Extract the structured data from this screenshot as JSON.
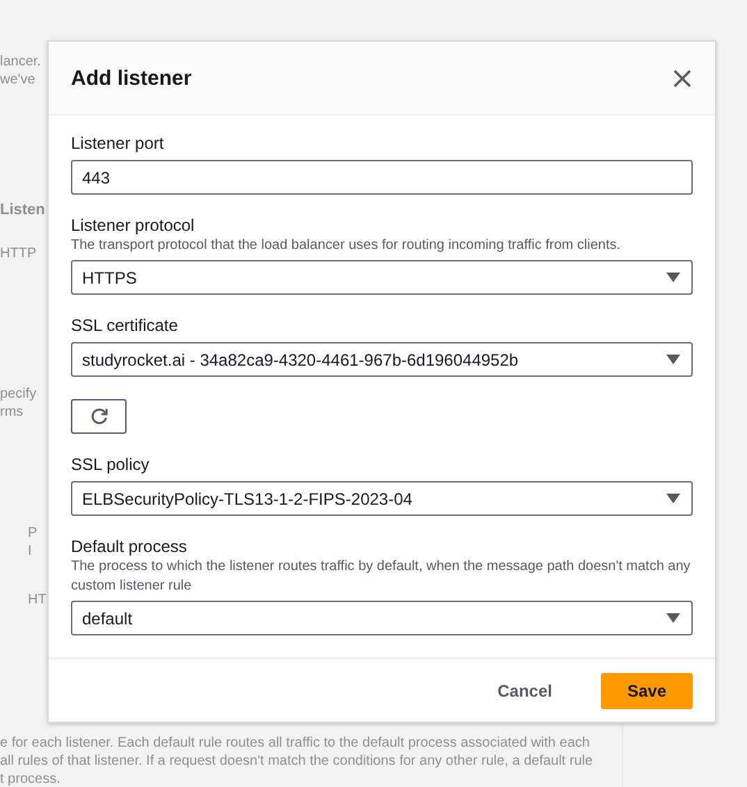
{
  "backdrop": {
    "groups": [
      {
        "kind": "note",
        "lines": [
          "lancer.",
          "we've"
        ]
      },
      {
        "kind": "heading",
        "lines": [
          "Listen"
        ]
      },
      {
        "kind": "cell",
        "lines": [
          "HTTP"
        ]
      },
      {
        "kind": "note",
        "lines": [
          "pecify",
          "rms"
        ]
      },
      {
        "kind": "cell",
        "lines": [
          "P",
          "I"
        ]
      },
      {
        "kind": "cell",
        "lines": [
          "HT"
        ]
      },
      {
        "kind": "paragraph",
        "lines": [
          "e for each listener. Each default rule routes all traffic to the default process associated with each",
          "all rules of that listener. If a request doesn't match the conditions for any other rule, a default rule",
          "t process."
        ]
      }
    ]
  },
  "modal": {
    "title": "Add listener",
    "fields": [
      {
        "kind": "text",
        "label": "Listener port",
        "value": "443"
      },
      {
        "kind": "select",
        "label": "Listener protocol",
        "description": "The transport protocol that the load balancer uses for routing incoming traffic from clients.",
        "value": "HTTPS"
      },
      {
        "kind": "select",
        "label": "SSL certificate",
        "value": "studyrocket.ai - 34a82ca9-4320-4461-967b-6d196044952b"
      },
      {
        "kind": "refresh"
      },
      {
        "kind": "select",
        "label": "SSL policy",
        "value": "ELBSecurityPolicy-TLS13-1-2-FIPS-2023-04"
      },
      {
        "kind": "select",
        "label": "Default process",
        "description": "The process to which the listener routes traffic by default, when the message path doesn't match any custom listener rule",
        "value": "default"
      }
    ],
    "buttons": [
      {
        "kind": "link",
        "label": "Cancel"
      },
      {
        "kind": "primary",
        "label": "Save"
      }
    ]
  }
}
